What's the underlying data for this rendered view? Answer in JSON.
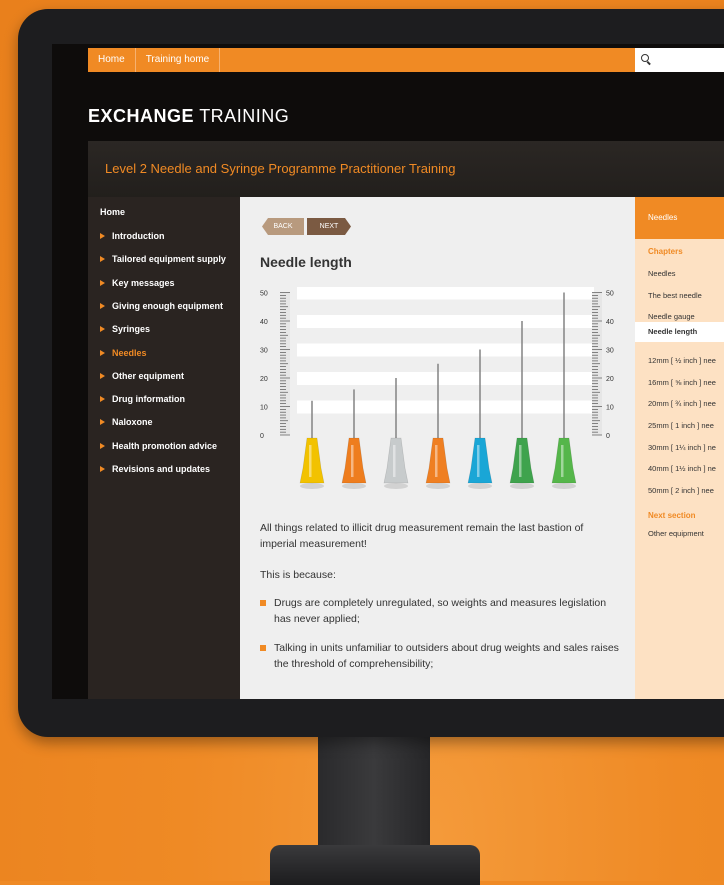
{
  "nav": {
    "home": "Home",
    "training_home": "Training home"
  },
  "brand": {
    "bold": "EXCHANGE",
    "light": " TRAINING"
  },
  "course_title": "Level 2 Needle and Syringe Programme Practitioner Training",
  "sidebar": {
    "home": "Home",
    "items": [
      "Introduction",
      "Tailored equipment supply",
      "Key messages",
      "Giving enough equipment",
      "Syringes",
      "Needles",
      "Other equipment",
      "Drug information",
      "Naloxone",
      "Health promotion advice",
      "Revisions and updates"
    ],
    "active_item": "Needles"
  },
  "buttons": {
    "back": "BACK",
    "next": "NEXT"
  },
  "page_title": "Needle length",
  "ruler": {
    "ticks": [
      "50",
      "40",
      "30",
      "20",
      "10",
      "0"
    ]
  },
  "needles": [
    {
      "hub_color": "#f2c200",
      "length_mm": 12
    },
    {
      "hub_color": "#ee7d1e",
      "length_mm": 16
    },
    {
      "hub_color": "#c7cbcc",
      "length_mm": 20
    },
    {
      "hub_color": "#ef7f22",
      "length_mm": 25
    },
    {
      "hub_color": "#1aa6d6",
      "length_mm": 30
    },
    {
      "hub_color": "#3fa34d",
      "length_mm": 40
    },
    {
      "hub_color": "#55b64a",
      "length_mm": 50
    }
  ],
  "body": {
    "p1": "All things related to illicit drug measurement remain the last bastion of imperial measurement!",
    "p2": "This is because:",
    "bullets": [
      "Drugs are completely unregulated, so weights and measures legislation has never applied;",
      "Talking in units unfamiliar to outsiders about drug weights and sales raises the threshold of comprehensibility;"
    ]
  },
  "right_panel": {
    "header": "Needles",
    "chapters_label": "Chapters",
    "chapters": [
      "Needles",
      "The best needle",
      "Needle gauge",
      "Needle length",
      "12mm [ ½ inch ] nee",
      "16mm [ ⅝ inch ] nee",
      "20mm [ ¾ inch ] nee",
      "25mm [ 1 inch ] nee",
      "30mm [ 1¼ inch ] ne",
      "40mm [ 1½ inch ] ne",
      "50mm [ 2 inch ] nee"
    ],
    "active_chapter": "Needle length",
    "next_section_label": "Next section",
    "next_section": "Other equipment"
  },
  "colors": {
    "accent": "#f08a24",
    "sidebar_bg": "#2a2421",
    "panel_bg": "#fde1c3"
  }
}
